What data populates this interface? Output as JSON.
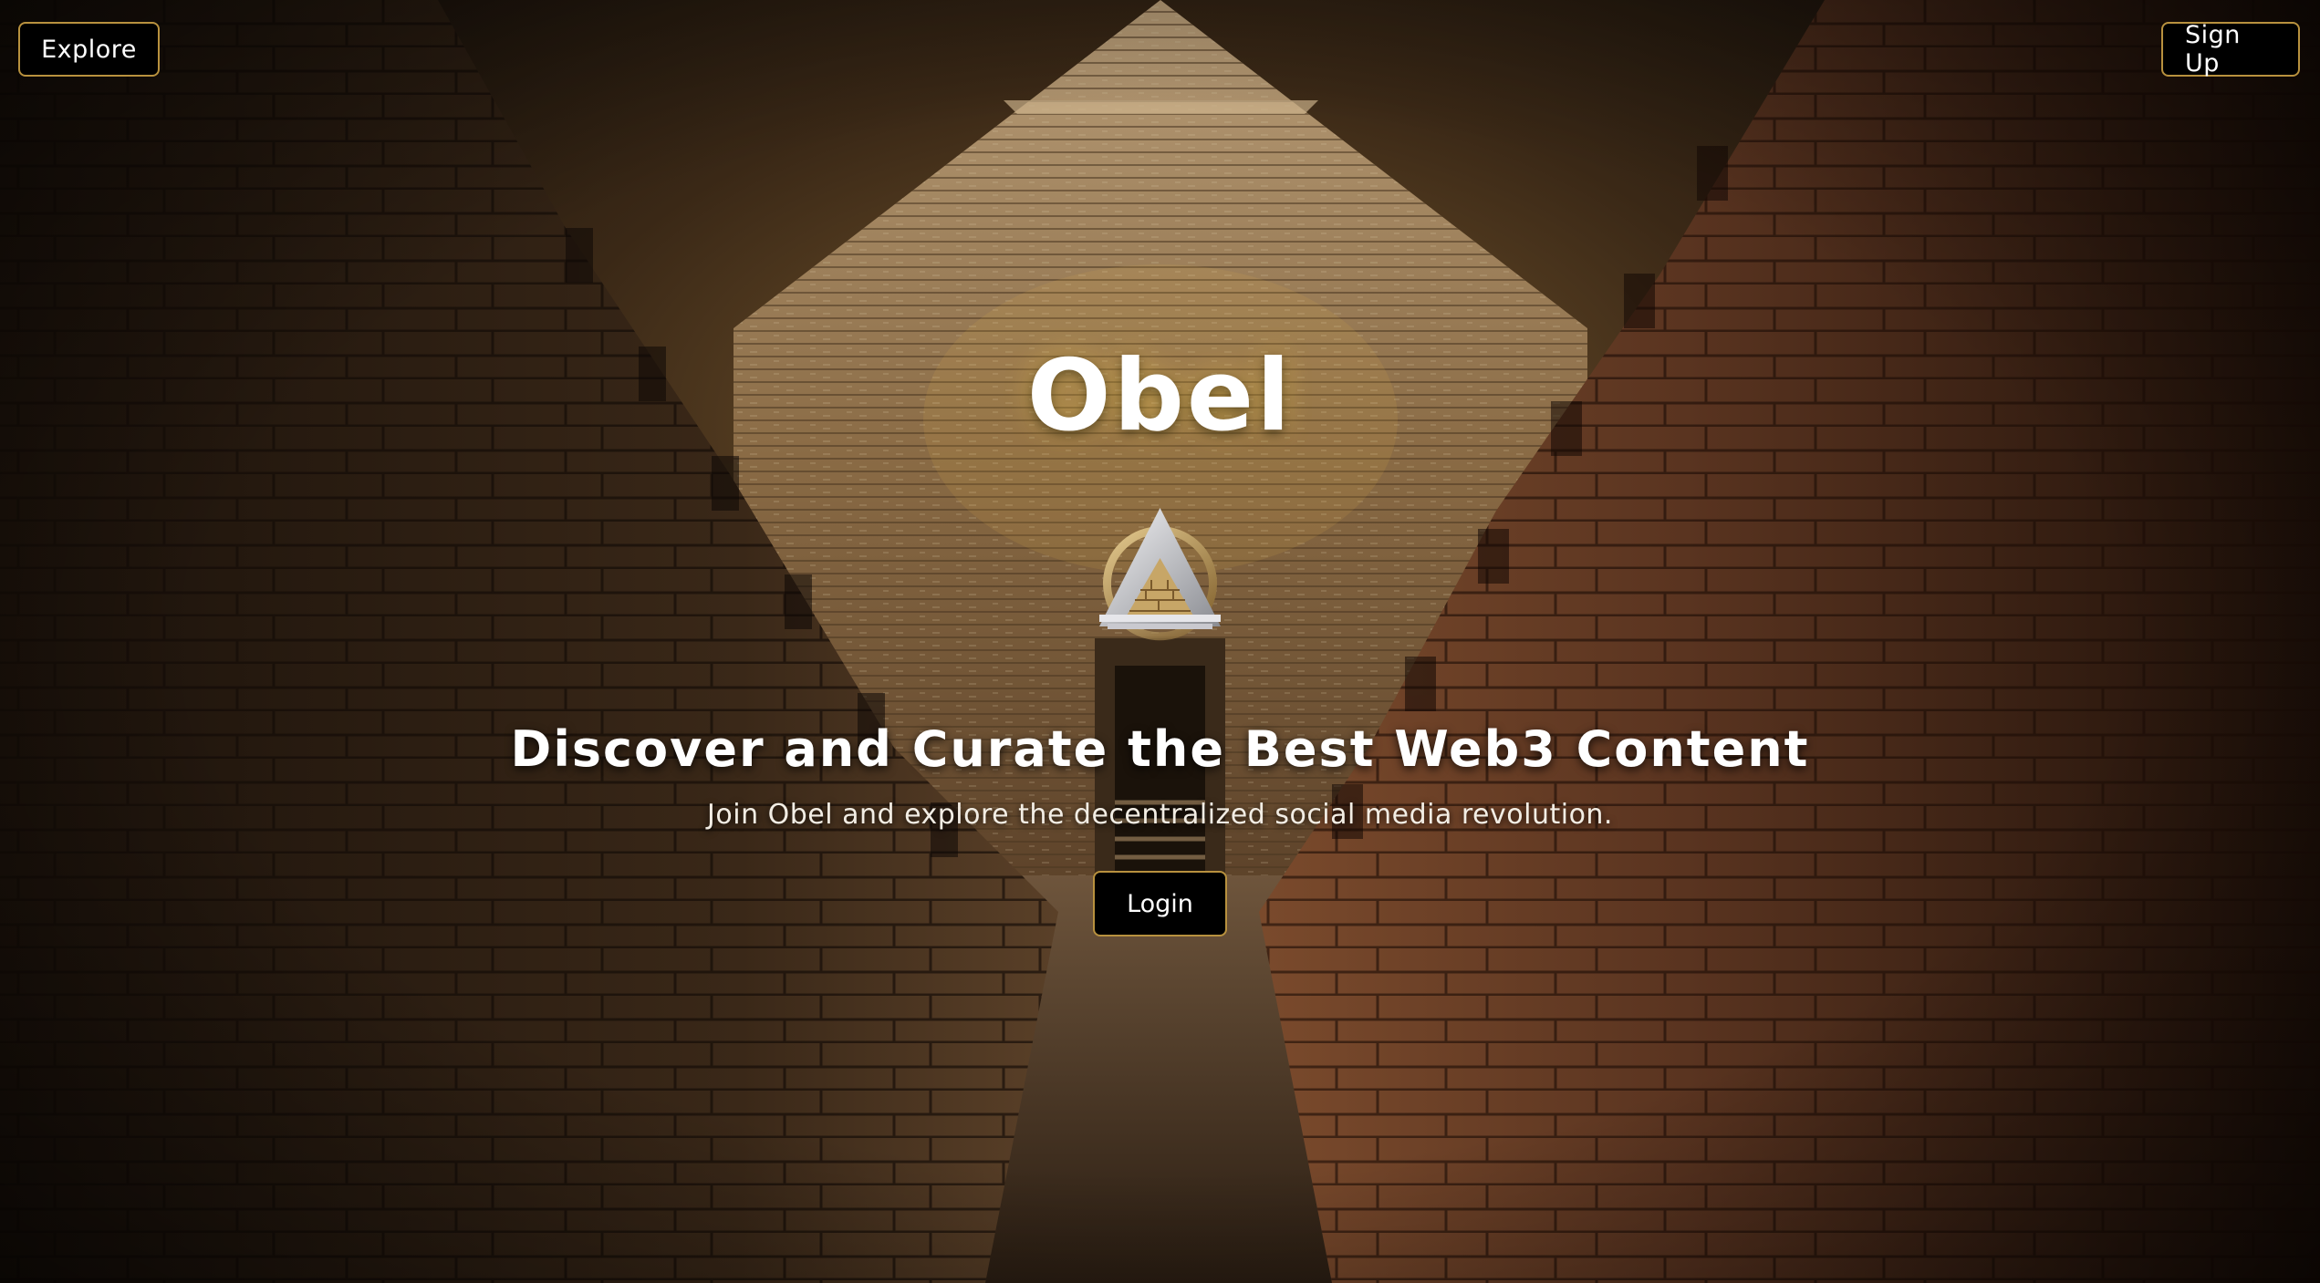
{
  "nav": {
    "explore_label": "Explore",
    "signup_label": "Sign Up"
  },
  "hero": {
    "title": "Obel",
    "headline": "Discover and Curate the Best Web3 Content",
    "subheadline": "Join Obel and explore the decentralized social media revolution.",
    "login_label": "Login",
    "logo_icon": "pyramid-logo-icon",
    "background_image": "pyramid-corridor-illustration"
  },
  "colors": {
    "button_border": "#b8913e",
    "button_bg": "#000000",
    "text": "#ffffff"
  }
}
